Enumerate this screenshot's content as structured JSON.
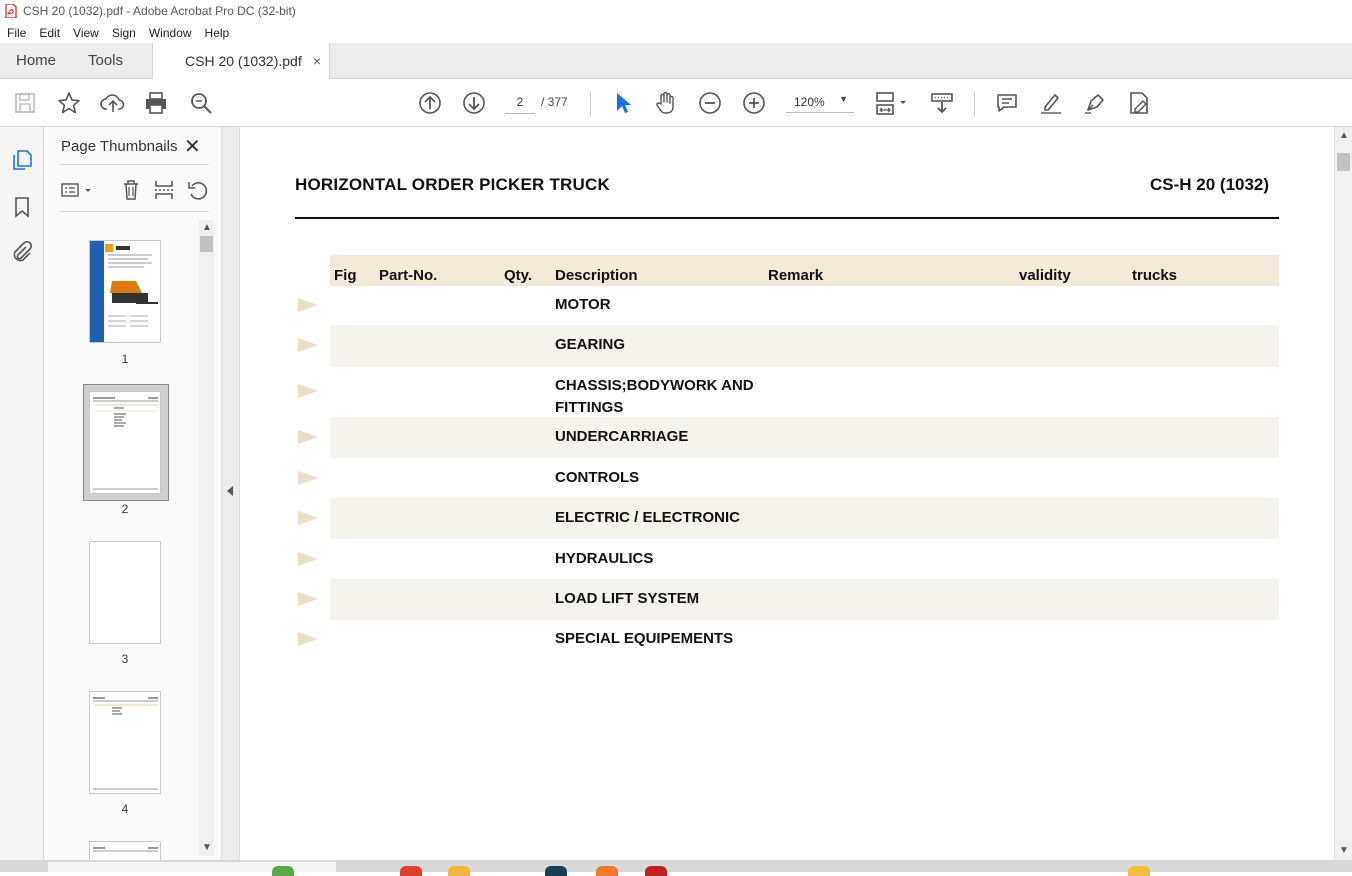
{
  "window": {
    "title": "CSH 20 (1032).pdf - Adobe Acrobat Pro DC (32-bit)"
  },
  "menu": [
    "File",
    "Edit",
    "View",
    "Sign",
    "Window",
    "Help"
  ],
  "tabs": {
    "home": "Home",
    "tools": "Tools",
    "document": "CSH 20 (1032).pdf",
    "close_glyph": "×"
  },
  "toolbar": {
    "current_page": "2",
    "page_total": "/ 377",
    "zoom": "120%",
    "zoom_arrow": "▼"
  },
  "sidebar": {
    "panel_title": "Page Thumbnails",
    "close_glyph": "✕",
    "thumbnails": [
      {
        "label": "1"
      },
      {
        "label": "2"
      },
      {
        "label": "3"
      },
      {
        "label": "4"
      }
    ]
  },
  "document": {
    "title": "HORIZONTAL ORDER PICKER TRUCK",
    "model": "CS-H 20 (1032)",
    "table_headers": {
      "fig": "Fig",
      "part_no": "Part-No.",
      "qty": "Qty.",
      "description": "Description",
      "remark": "Remark",
      "validity": "validity",
      "trucks": "trucks"
    },
    "rows": [
      {
        "description": "MOTOR"
      },
      {
        "description": "GEARING"
      },
      {
        "description": "CHASSIS;BODYWORK AND FITTINGS"
      },
      {
        "description": "UNDERCARRIAGE"
      },
      {
        "description": "CONTROLS"
      },
      {
        "description": "ELECTRIC / ELECTRONIC"
      },
      {
        "description": "HYDRAULICS"
      },
      {
        "description": "LOAD LIFT SYSTEM"
      },
      {
        "description": "SPECIAL EQUIPEMENTS"
      }
    ]
  },
  "icons": {
    "toolbar": [
      "save-icon",
      "star-icon",
      "upload-icon",
      "print-icon",
      "search-icon",
      "prev-page-icon",
      "next-page-icon",
      "select-cursor-icon",
      "hand-icon",
      "zoom-out-icon",
      "zoom-in-icon",
      "page-fit-icon",
      "scroll-mode-icon",
      "comment-icon",
      "highlight-icon",
      "draw-icon",
      "fill-sign-icon"
    ],
    "rail": [
      "pages-icon",
      "bookmark-icon",
      "attachment-icon"
    ]
  },
  "colors": {
    "header_band": "#f3e9d8",
    "row_shade": "#f5f3ee",
    "row_arrow": "#eadfc8",
    "acrobat_red": "#d71f1f",
    "selection_blue": "#1473e6"
  }
}
